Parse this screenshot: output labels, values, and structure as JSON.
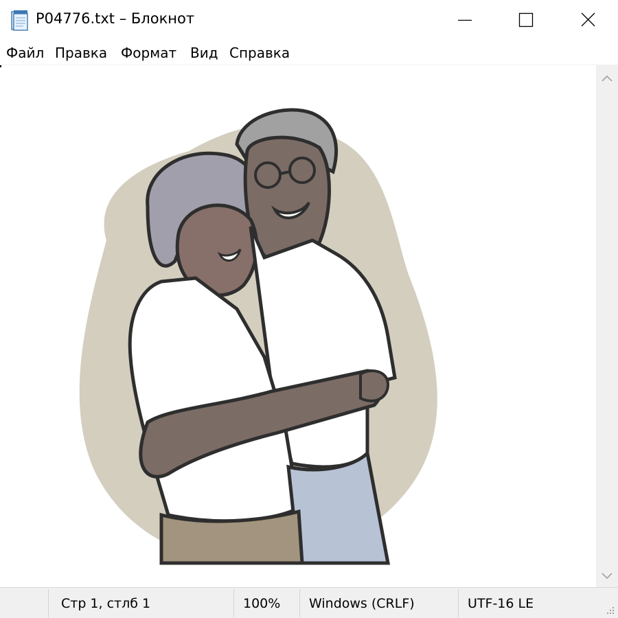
{
  "window": {
    "title": "P04776.txt – Блокнот"
  },
  "menu": {
    "items": [
      "Файл",
      "Правка",
      "Формат",
      "Вид",
      "Справка"
    ]
  },
  "status": {
    "position": "Стр 1, стлб 1",
    "zoom": "100%",
    "line_endings": "Windows (CRLF)",
    "encoding": "UTF-16 LE"
  },
  "icons": {
    "app": "notepad-icon",
    "minimize": "minimize-icon",
    "maximize": "maximize-icon",
    "close": "close-icon",
    "scroll_up": "chevron-up-icon",
    "scroll_down": "chevron-down-icon"
  },
  "colors": {
    "background": "#ffffff",
    "chrome": "#f0f0f0",
    "text": "#000000"
  }
}
